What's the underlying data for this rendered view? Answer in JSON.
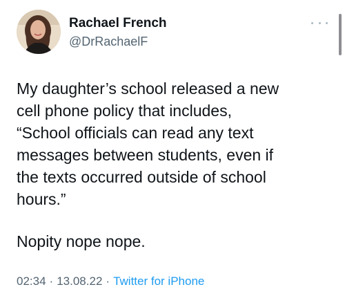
{
  "user": {
    "display_name": "Rachael French",
    "handle": "@DrRachaelF"
  },
  "tweet": {
    "text": "My daughter’s school released a new\ncell phone policy that includes,\n“School officials can read any text\nmessages between students, even if\nthe texts occurred outside of school\nhours.”",
    "followup": "Nopity nope nope."
  },
  "meta": {
    "time": "02:34",
    "date": "13.08.22",
    "separator": "·",
    "source": "Twitter for iPhone"
  },
  "icons": {
    "more": "more-horizontal-icon",
    "avatar": "profile-photo"
  },
  "colors": {
    "text": "#0f1419",
    "secondary": "#536471",
    "link": "#1d9bf0"
  }
}
